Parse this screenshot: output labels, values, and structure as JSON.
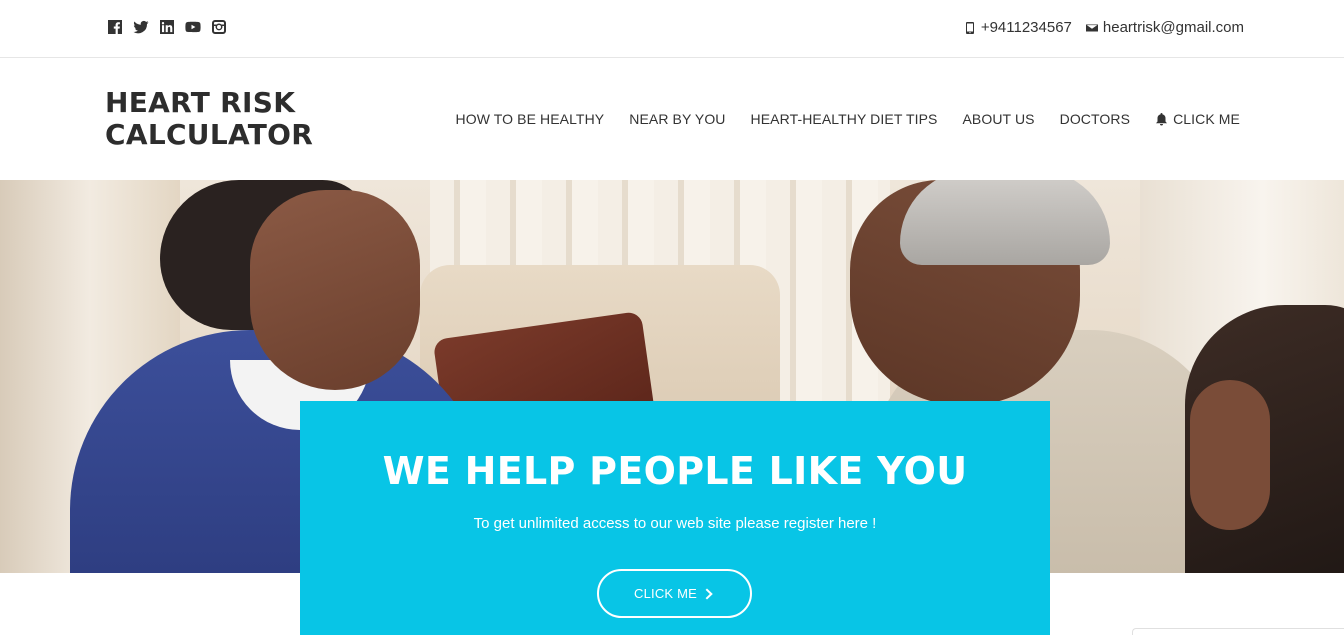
{
  "topbar": {
    "social": [
      {
        "icon": "facebook-icon"
      },
      {
        "icon": "twitter-icon"
      },
      {
        "icon": "linkedin-icon"
      },
      {
        "icon": "youtube-icon"
      },
      {
        "icon": "instagram-icon"
      }
    ],
    "phone": "+9411234567",
    "email": "heartrisk@gmail.com"
  },
  "header": {
    "logo_line1": "HEART RISK",
    "logo_line2": "CALCULATOR",
    "nav": [
      "HOW TO BE HEALTHY",
      "NEAR BY YOU",
      "HEART-HEALTHY DIET TIPS",
      "ABOUT US",
      "DOCTORS",
      "CLICK ME"
    ]
  },
  "hero": {
    "headline": "WE HELP PEOPLE LIKE YOU",
    "subtext": "To get unlimited access to our web site please register here !",
    "button_label": "CLICK ME"
  },
  "colors": {
    "accent": "#08c5e6",
    "text": "#333333"
  }
}
